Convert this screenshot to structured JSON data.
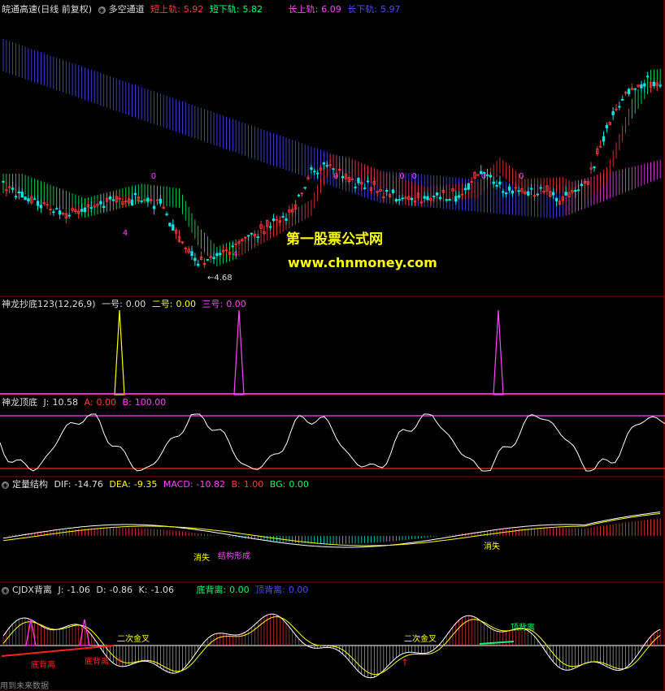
{
  "colors": {
    "bg": "#000000",
    "frame": "#9a0000",
    "up": "#ff3b3b",
    "down": "#00e5e5",
    "green": "#00ff66",
    "blue": "#4a4aff",
    "magenta": "#ff44ff",
    "yellow": "#ffff00",
    "white": "#ffffff",
    "red": "#ff2020"
  },
  "main": {
    "title": "皖通高速(日线 前复权)",
    "indicator": "多空通道",
    "short_upper_label": "短上轨",
    "short_upper_value": "5.92",
    "short_lower_label": "短下轨",
    "short_lower_value": "5.82",
    "long_upper_label": "长上轨",
    "long_upper_value": "6.09",
    "long_lower_label": "长下轨",
    "long_lower_value": "5.97",
    "low_price": "4.68",
    "watermark_title": "第一股票公式网",
    "watermark_url": "www.chnmoney.com",
    "markers": [
      {
        "text": "0",
        "idx": 47
      },
      {
        "text": "4",
        "idx": 38
      },
      {
        "text": "4",
        "idx": 73
      },
      {
        "text": "0",
        "idx": 105
      },
      {
        "text": "0",
        "idx": 130
      },
      {
        "text": "0",
        "idx": 152
      },
      {
        "text": "0",
        "idx": 126
      },
      {
        "text": "0",
        "idx": 164
      }
    ]
  },
  "panel2": {
    "name": "神龙抄底123(12,26,9)",
    "one_label": "一号",
    "one_value": "0.00",
    "two_label": "二号",
    "two_value": "0.00",
    "three_label": "三号",
    "three_value": "0.00"
  },
  "panel3": {
    "name": "神龙顶底",
    "j_label": "J",
    "j_value": "10.58",
    "a_label": "A",
    "a_value": "0.00",
    "b_label": "B",
    "b_value": "100.00"
  },
  "panel4": {
    "name": "定量结构",
    "dif_label": "DIF",
    "dif_value": "-14.76",
    "dea_label": "DEA",
    "dea_value": "-9.35",
    "macd_label": "MACD",
    "macd_value": "-10.82",
    "b_label": "B",
    "b_value": "1.00",
    "bg_label": "BG",
    "bg_value": "0.00",
    "annotations": [
      "消失",
      "结构形成",
      "消失"
    ]
  },
  "panel5": {
    "name": "CJDX背离",
    "j_label": "J",
    "j_value": "-1.06",
    "d_label": "D",
    "d_value": "-0.86",
    "k_label": "K",
    "k_value": "-1.06",
    "bottom_div_label": "底背离",
    "bottom_div_value": "0.00",
    "top_div_label": "顶背离",
    "top_div_value": "0.00",
    "annotations": [
      "底背离",
      "底背离",
      "二次金叉",
      "二次金叉",
      "顶背离"
    ]
  },
  "footer": "用到未来数据"
}
